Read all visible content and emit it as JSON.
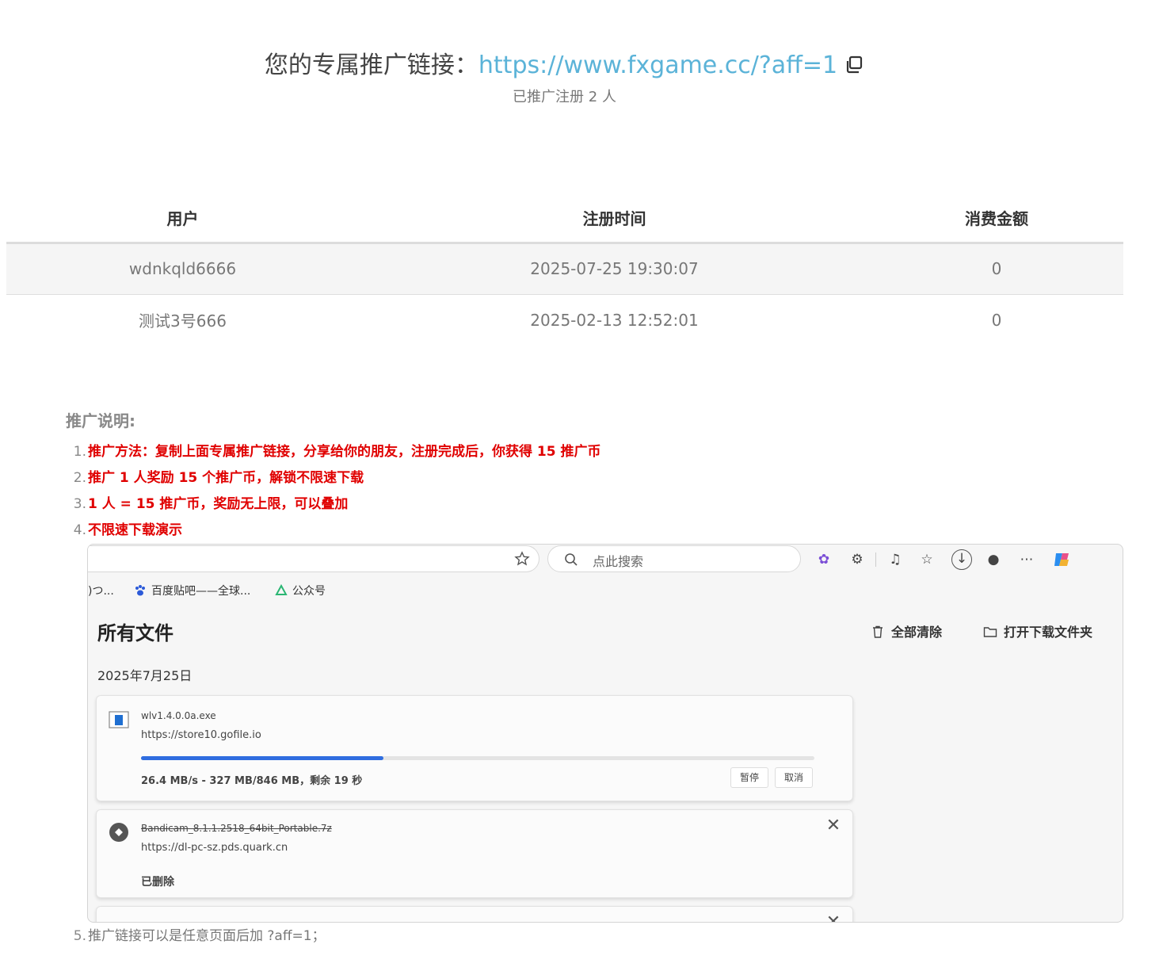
{
  "header": {
    "prefix": "您的专属推广链接：",
    "link": "https://www.fxgame.cc/?aff=1",
    "count_text": "已推广注册 2 人"
  },
  "table": {
    "columns": [
      "用户",
      "注册时间",
      "消费金额"
    ],
    "rows": [
      {
        "user": "wdnkqld6666",
        "time": "2025-07-25 19:30:07",
        "amount": "0"
      },
      {
        "user": "测试3号666",
        "time": "2025-02-13 12:52:01",
        "amount": "0"
      }
    ]
  },
  "instructions": {
    "title": "推广说明:",
    "items": [
      {
        "num": "1.",
        "text": "推广方法：复制上面专属推广链接，分享给你的朋友，注册完成后，你获得 15 推广币"
      },
      {
        "num": "2.",
        "text": "推广 1 人奖励 15 个推广币，解锁不限速下载"
      },
      {
        "num": "3.",
        "text": "1 人 = 15 推广币，奖励无上限，可以叠加"
      },
      {
        "num": "4.",
        "text": "不限速下载演示"
      },
      {
        "num": "5.",
        "text": "推广链接可以是任意页面后加 ?aff=1；"
      }
    ]
  },
  "screenshot": {
    "search_placeholder": "点此搜索",
    "bookmarks": [
      ")つ...",
      "百度贴吧——全球...",
      "公众号"
    ],
    "title": "所有文件",
    "clear_all": "全部清除",
    "open_folder": "打开下载文件夹",
    "date": "2025年7月25日",
    "downloads": [
      {
        "name": "wlv1.4.0.0a.exe",
        "url": "https://store10.gofile.io",
        "status": "26.4 MB/s - 327 MB/846 MB，剩余 19 秒",
        "progress": 0.36,
        "pause": "暂停",
        "cancel": "取消"
      },
      {
        "name": "Bandicam_8.1.1.2518_64bit_Portable.7z",
        "url": "https://dl-pc-sz.pds.quark.cn",
        "status": "已删除"
      }
    ],
    "accent": "#2f6de0"
  },
  "colors": {
    "link": "#5bb3d8",
    "instruction_red": "#e00000"
  }
}
